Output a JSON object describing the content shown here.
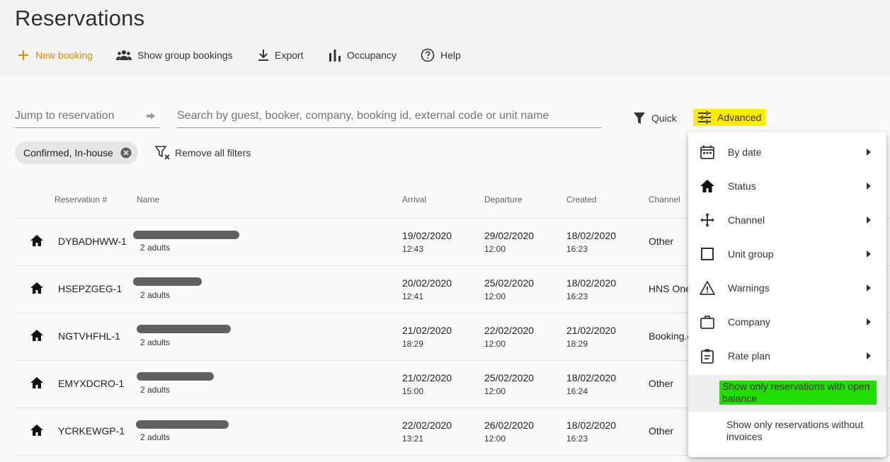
{
  "header": {
    "title": "Reservations",
    "toolbar": {
      "new_booking": "New booking",
      "group_bookings": "Show group bookings",
      "export": "Export",
      "occupancy": "Occupancy",
      "help": "Help"
    }
  },
  "search": {
    "jump_placeholder": "Jump to reservation",
    "search_placeholder": "Search by guest, booker, company, booking id, external code or unit name"
  },
  "filters": {
    "quick_label": "Quick",
    "advanced_label": "Advanced",
    "active_chip": "Confirmed, In-house",
    "remove_all": "Remove all filters"
  },
  "table": {
    "columns": [
      "Reservation #",
      "Name",
      "Arrival",
      "Departure",
      "Created",
      "Channel"
    ],
    "rows": [
      {
        "id": "DYBADHWW-1",
        "guests": "2 adults",
        "arrival_date": "19/02/2020",
        "arrival_time": "12:43",
        "departure_date": "29/02/2020",
        "departure_time": "12:00",
        "created_date": "18/02/2020",
        "created_time": "16:23",
        "channel": "Other"
      },
      {
        "id": "HSEPZGEG-1",
        "guests": "2 adults",
        "arrival_date": "20/02/2020",
        "arrival_time": "12:41",
        "departure_date": "25/02/2020",
        "departure_time": "12:00",
        "created_date": "18/02/2020",
        "created_time": "16:23",
        "channel": "HNS One"
      },
      {
        "id": "NGTVHFHL-1",
        "guests": "2 adults",
        "arrival_date": "21/02/2020",
        "arrival_time": "18:29",
        "departure_date": "22/02/2020",
        "departure_time": "12:00",
        "created_date": "21/02/2020",
        "created_time": "18:29",
        "channel": "Booking.c"
      },
      {
        "id": "EMYXDCRO-1",
        "guests": "2 adults",
        "arrival_date": "21/02/2020",
        "arrival_time": "15:00",
        "departure_date": "25/02/2020",
        "departure_time": "12:00",
        "created_date": "18/02/2020",
        "created_time": "16:24",
        "channel": "Other"
      },
      {
        "id": "YCRKEWGP-1",
        "guests": "2 adults",
        "arrival_date": "22/02/2020",
        "arrival_time": "13:21",
        "departure_date": "26/02/2020",
        "departure_time": "12:00",
        "created_date": "18/02/2020",
        "created_time": "16:23",
        "channel": "Other"
      }
    ]
  },
  "advanced_menu": {
    "items": [
      {
        "label": "By date",
        "icon": "calendar-icon"
      },
      {
        "label": "Status",
        "icon": "house-icon"
      },
      {
        "label": "Channel",
        "icon": "move-arrows-icon"
      },
      {
        "label": "Unit group",
        "icon": "square-icon"
      },
      {
        "label": "Warnings",
        "icon": "warning-icon"
      },
      {
        "label": "Company",
        "icon": "briefcase-icon"
      },
      {
        "label": "Rate plan",
        "icon": "clipboard-icon"
      }
    ],
    "open_balance": "Show only reservations with open balance",
    "without_invoices": "Show only reservations without invoices"
  },
  "colors": {
    "accent": "#e08a00",
    "advanced_highlight": "#ffeb00",
    "option_highlight": "#22dd00"
  }
}
